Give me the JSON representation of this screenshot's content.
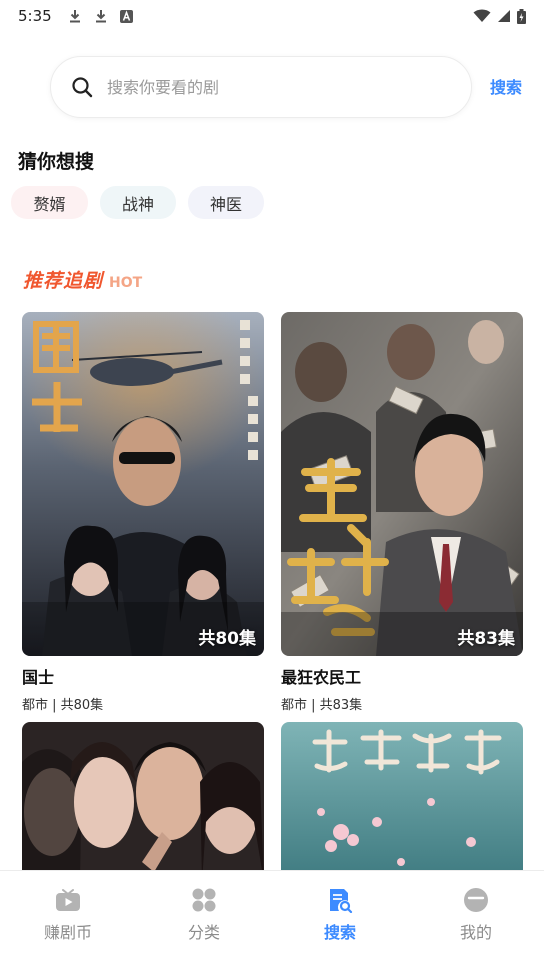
{
  "status_bar": {
    "time": "5:35",
    "left_icons": [
      "download-icon",
      "download-icon",
      "notification-a-icon"
    ],
    "right_icons": [
      "wifi-icon",
      "signal-icon",
      "battery-charging-icon"
    ]
  },
  "search": {
    "placeholder": "搜索你要看的剧",
    "button_label": "搜索"
  },
  "guess": {
    "title": "猜你想搜",
    "chips": [
      "赘婿",
      "战神",
      "神医"
    ]
  },
  "recommend": {
    "title": "推荐追剧",
    "hot": "HOT",
    "items": [
      {
        "title": "国士",
        "meta": "都市 | 共80集",
        "episodes": "共80集"
      },
      {
        "title": "最狂农民工",
        "meta": "都市 | 共83集",
        "episodes": "共83集"
      },
      {
        "title": "",
        "meta": "",
        "episodes": ""
      },
      {
        "title": "",
        "meta": "",
        "episodes": ""
      }
    ]
  },
  "nav": {
    "items": [
      {
        "label": "赚剧币",
        "icon": "tv-play-icon",
        "active": false
      },
      {
        "label": "分类",
        "icon": "grid-category-icon",
        "active": false
      },
      {
        "label": "搜索",
        "icon": "search-document-icon",
        "active": true
      },
      {
        "label": "我的",
        "icon": "profile-face-icon",
        "active": false
      }
    ]
  },
  "colors": {
    "accent": "#3d8bff",
    "hot_title": "#f0572f",
    "hot_tag": "#f4a586",
    "inactive": "#8c8c8c"
  }
}
